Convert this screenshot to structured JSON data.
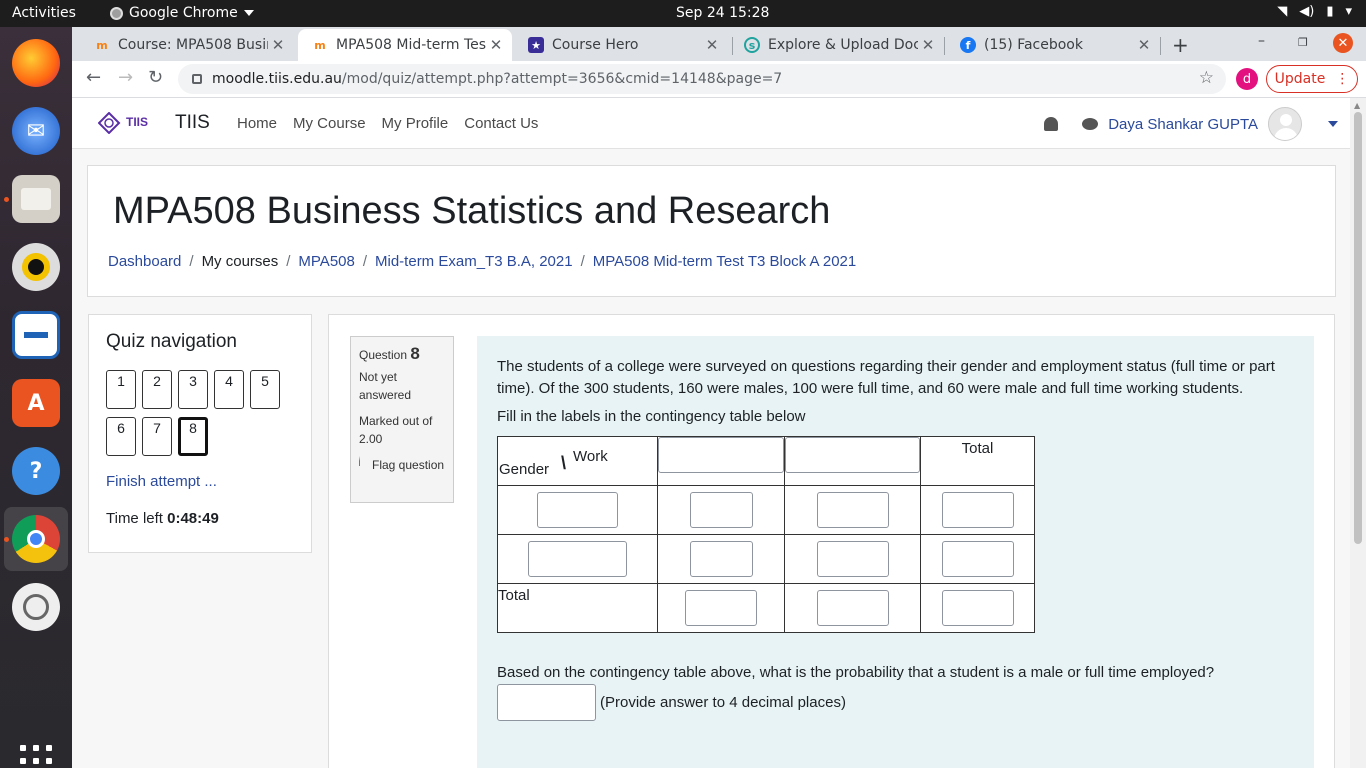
{
  "os": {
    "activities": "Activities",
    "app_name": "Google Chrome",
    "clock": "Sep 24  15:28"
  },
  "browser": {
    "tabs": [
      {
        "label": "Course: MPA508 Busin",
        "favicon": "moodle-icon"
      },
      {
        "label": "MPA508 Mid-term Test",
        "favicon": "moodle-icon"
      },
      {
        "label": "Course Hero",
        "favicon": "coursehero-icon"
      },
      {
        "label": "Explore & Upload Doc",
        "favicon": "studocu-icon"
      },
      {
        "label": "(15) Facebook",
        "favicon": "facebook-icon"
      }
    ],
    "url_host": "moodle.tiis.edu.au",
    "url_path": "/mod/quiz/attempt.php?attempt=3656&cmid=14148&page=7",
    "profile_initial": "d",
    "update_label": "Update"
  },
  "site": {
    "logo_text": "TIIS",
    "name": "TIIS",
    "nav": [
      "Home",
      "My Course",
      "My Profile",
      "Contact Us"
    ],
    "user_name": "Daya Shankar GUPTA"
  },
  "header": {
    "course_title": "MPA508 Business Statistics and Research",
    "breadcrumb": [
      "Dashboard",
      "My courses",
      "MPA508",
      "Mid-term Exam_T3 B.A, 2021",
      "MPA508 Mid-term Test T3 Block A 2021"
    ]
  },
  "quiz_nav": {
    "title": "Quiz navigation",
    "questions": [
      "1",
      "2",
      "3",
      "4",
      "5",
      "6",
      "7",
      "8"
    ],
    "current": "8",
    "finish_label": "Finish attempt ...",
    "time_label": "Time left",
    "time_value": "0:48:49"
  },
  "question": {
    "label": "Question",
    "number": "8",
    "status": "Not yet answered",
    "marks": "Marked out of 2.00",
    "flag_label": "Flag question",
    "text": "The students of a college were surveyed on questions regarding their gender and employment status (full time or part time).  Of the 300 students, 160 were males, 100 were full time, and 60 were male and full time working students.",
    "fill_instruction": "Fill in the labels in the contingency table below",
    "table": {
      "corner_gender": "Gender",
      "corner_slash": "\\",
      "corner_work": "Work",
      "total_col": "Total",
      "total_row": "Total"
    },
    "followup": "Based on the contingency table above, what is the probability that a student is a male or full time employed?",
    "answer_hint": "(Provide answer to 4 decimal places)"
  }
}
